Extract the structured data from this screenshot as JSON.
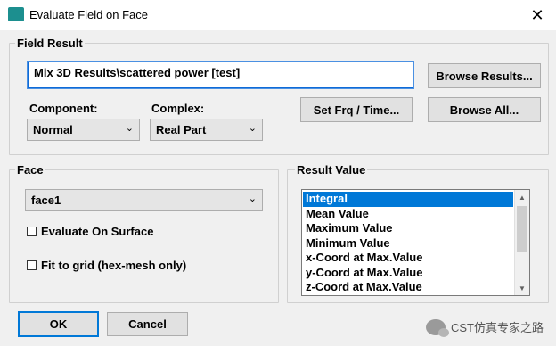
{
  "window": {
    "title": "Evaluate Field on Face",
    "close_glyph": "✕",
    "icon": "app-icon"
  },
  "field_result": {
    "legend": "Field Result",
    "value": "Mix 3D Results\\scattered power [test]",
    "browse_results_label": "Browse Results...",
    "browse_all_label": "Browse All...",
    "set_frq_label": "Set Frq / Time...",
    "component_label": "Component:",
    "component_value": "Normal",
    "complex_label": "Complex:",
    "complex_value": "Real Part"
  },
  "face": {
    "legend": "Face",
    "selected": "face1",
    "evaluate_on_surface_label": "Evaluate On Surface",
    "evaluate_on_surface_checked": false,
    "fit_to_grid_label": "Fit to grid (hex-mesh only)",
    "fit_to_grid_checked": false
  },
  "result_value": {
    "legend": "Result Value",
    "items": [
      "Integral",
      "Mean Value",
      "Maximum Value",
      "Minimum Value",
      "x-Coord at Max.Value",
      "y-Coord at Max.Value",
      "z-Coord at Max.Value"
    ],
    "selected_index": 0
  },
  "footer": {
    "ok_label": "OK",
    "cancel_label": "Cancel"
  },
  "watermark": {
    "text": "CST仿真专家之路"
  },
  "colors": {
    "accent": "#0078d7",
    "dialog_bg": "#f0f0f0"
  }
}
